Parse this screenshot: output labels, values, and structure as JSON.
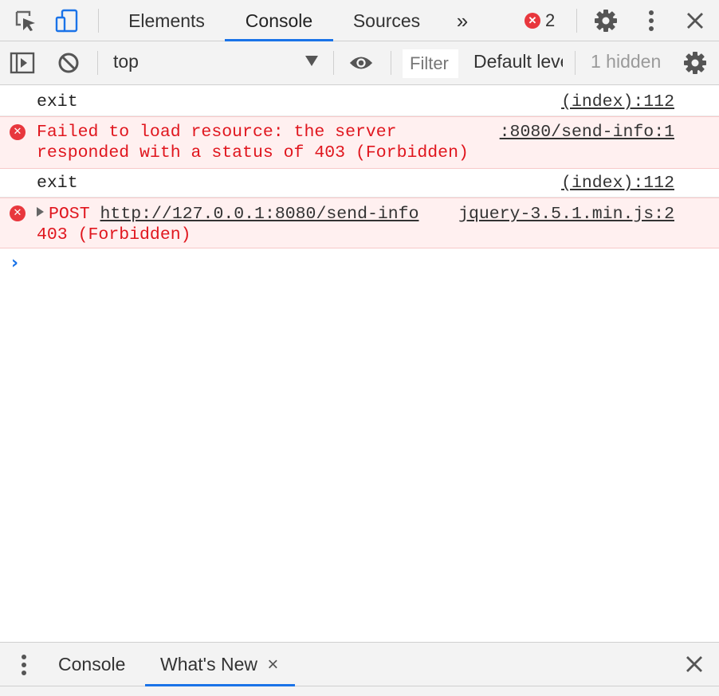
{
  "topbar": {
    "tabs": [
      {
        "label": "Elements"
      },
      {
        "label": "Console"
      },
      {
        "label": "Sources"
      }
    ],
    "more_tabs_label": "»",
    "error_count": "2",
    "icons": [
      "inspect-element-icon",
      "device-toolbar-icon",
      "settings-gear-icon",
      "kebab-menu-icon",
      "close-icon"
    ]
  },
  "toolbar": {
    "context": "top",
    "filter_placeholder": "Filter",
    "levels": "Default levels",
    "hidden": "1 hidden"
  },
  "messages": [
    {
      "type": "log",
      "text": "exit",
      "source": "(index):112"
    },
    {
      "type": "error",
      "text": "Failed to load resource: the server\nresponded with a status of 403 (Forbidden)",
      "source": ":8080/send-info:1"
    },
    {
      "type": "log",
      "text": "exit",
      "source": "(index):112"
    },
    {
      "type": "error",
      "method": "POST",
      "url": "http://127.0.0.1:8080/send-info",
      "status": "403 (Forbidden)",
      "source": "jquery-3.5.1.min.js:2"
    }
  ],
  "drawer": {
    "tabs": [
      {
        "label": "Console"
      },
      {
        "label": "What's New"
      }
    ],
    "close_tab_glyph": "×"
  },
  "colors": {
    "accent": "#1a73e8",
    "error_text": "#e0161e",
    "error_bg": "#fff0f0",
    "error_badge": "#e8373d"
  }
}
